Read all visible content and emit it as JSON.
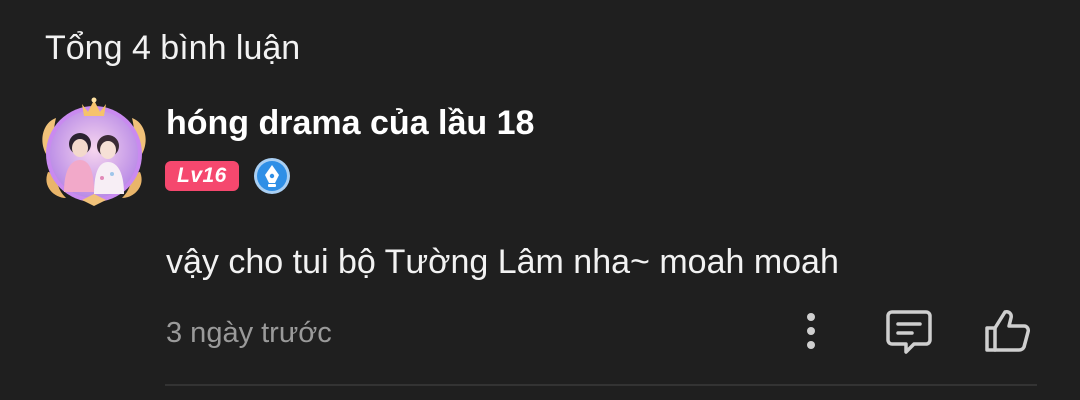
{
  "comments_header": {
    "total_label": "Tổng 4 bình luận"
  },
  "comment": {
    "username": "hóng drama của lầu 18",
    "level_badge": "Lv16",
    "creator_badge_icon": "pen-nib-icon",
    "text": "vậy cho tui bộ Tường Lâm nha~ moah moah",
    "timestamp": "3 ngày trước",
    "actions": {
      "more_icon": "more-vertical-icon",
      "reply_icon": "comment-icon",
      "like_icon": "thumbs-up-icon"
    }
  },
  "colors": {
    "background": "#1f1f1f",
    "level_badge": "#f5486e",
    "creator_badge": "#2f8fe6",
    "muted_text": "#9a9a9a",
    "icon": "#cfcfcf"
  }
}
